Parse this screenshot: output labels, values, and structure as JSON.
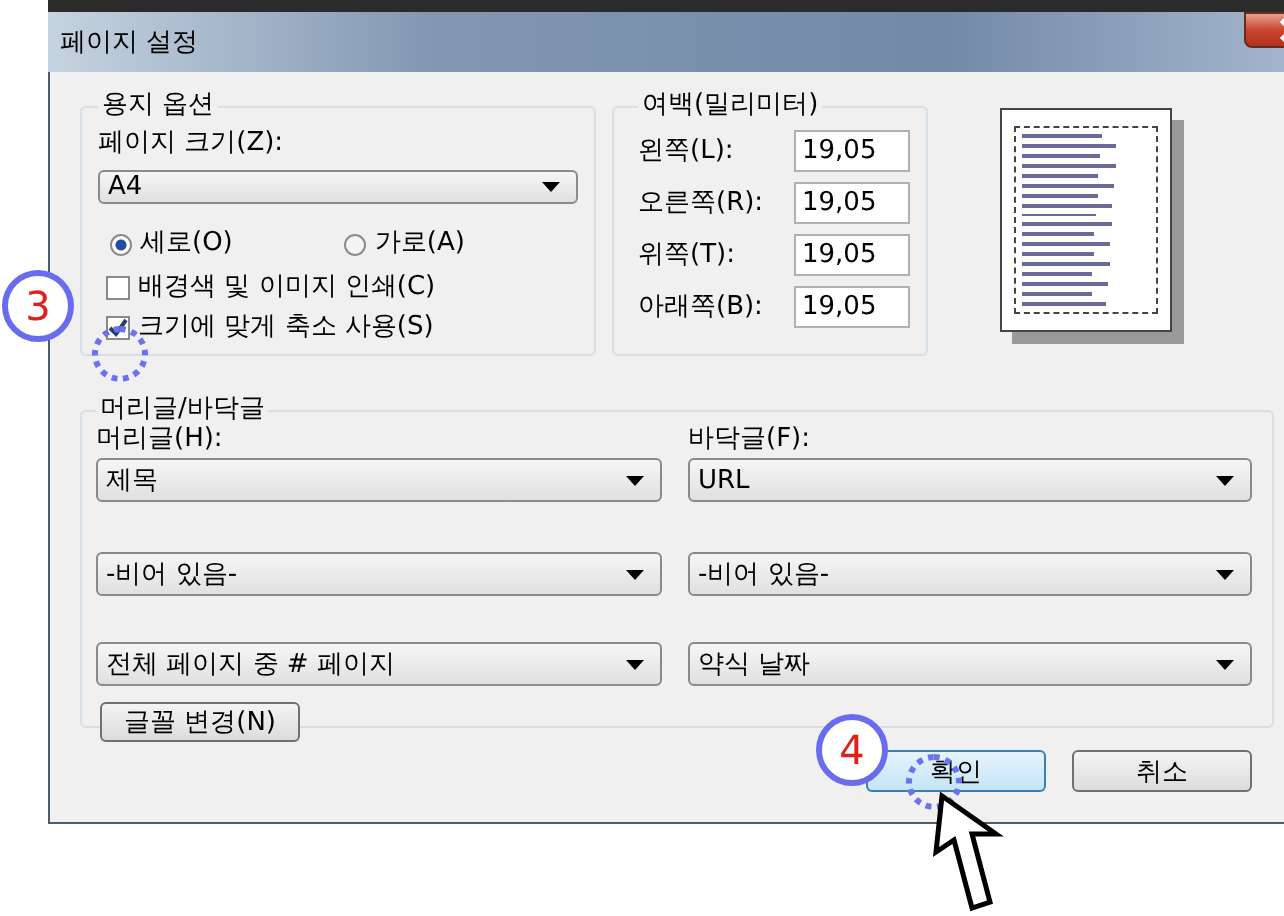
{
  "window": {
    "title": "페이지 설정"
  },
  "paper_options": {
    "label": "용지 옵션",
    "page_size_label": "페이지 크기(Z):",
    "page_size": "A4",
    "orientation": [
      {
        "label": "세로(O)",
        "selected": true
      },
      {
        "label": "가로(A)",
        "selected": false
      }
    ],
    "checkboxes": [
      {
        "label": "배경색 및 이미지 인쇄(C)",
        "checked": false
      },
      {
        "label": "크기에 맞게 축소 사용(S)",
        "checked": true
      }
    ]
  },
  "margins": {
    "label": "여백(밀리미터)",
    "fields": [
      {
        "label": "왼쪽(L):",
        "value": "19,05"
      },
      {
        "label": "오른쪽(R):",
        "value": "19,05"
      },
      {
        "label": "위쪽(T):",
        "value": "19,05"
      },
      {
        "label": "아래쪽(B):",
        "value": "19,05"
      }
    ]
  },
  "header_footer": {
    "label": "머리글/바닥글",
    "header_label": "머리글(H):",
    "footer_label": "바닥글(F):",
    "header": [
      "제목",
      "-비어 있음-",
      "전체 페이지 중 # 페이지"
    ],
    "footer": [
      "URL",
      "-비어 있음-",
      "약식 날짜"
    ],
    "font_button": "글꼴 변경(N)"
  },
  "buttons": [
    {
      "label": "확인",
      "kind": "default"
    },
    {
      "label": "취소",
      "kind": "normal"
    }
  ],
  "annotations": [
    {
      "label": "3"
    },
    {
      "label": "4"
    }
  ]
}
